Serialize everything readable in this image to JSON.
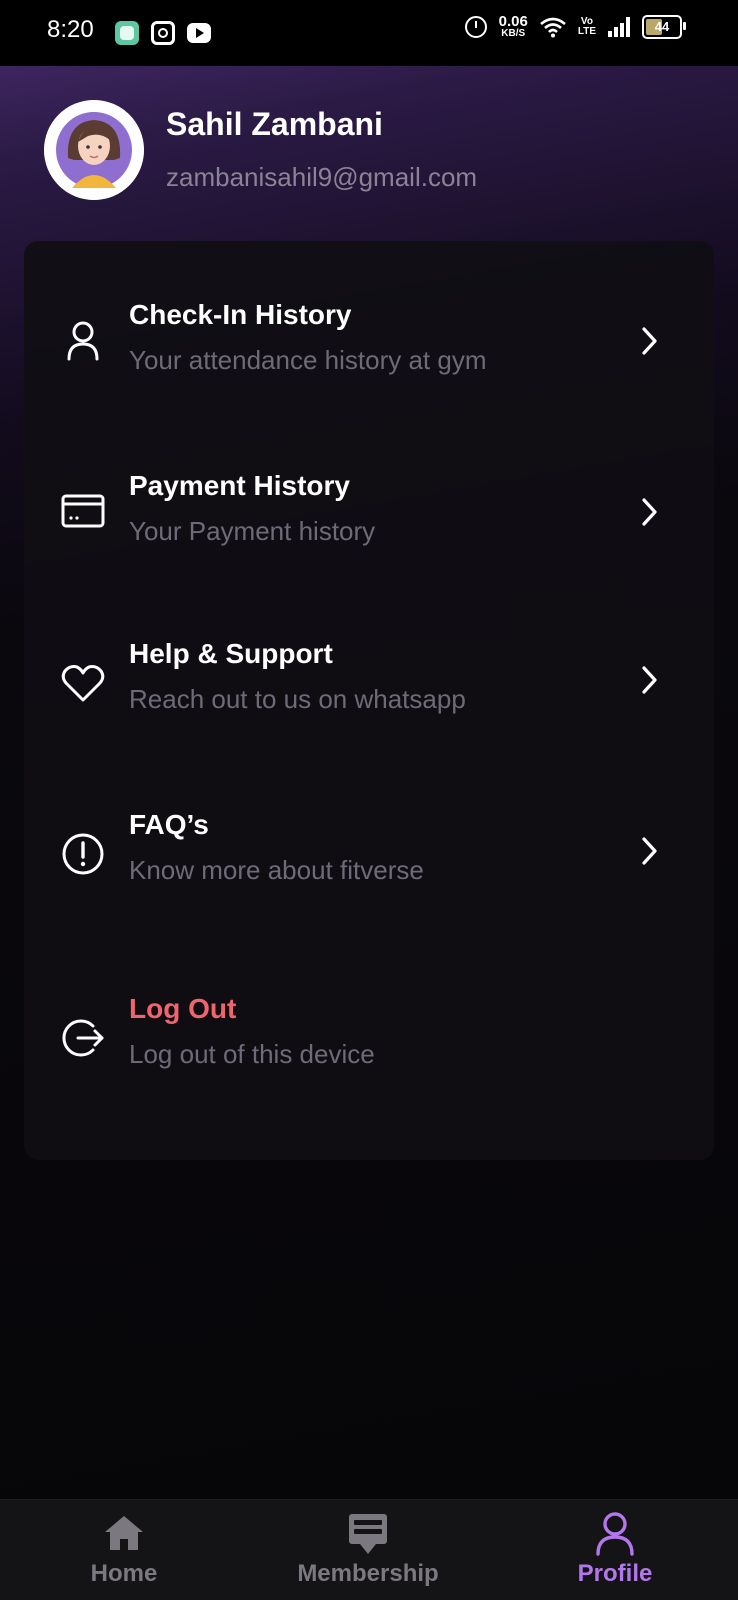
{
  "status_bar": {
    "time": "8:20",
    "net_speed_value": "0.06",
    "net_speed_unit": "KB/S",
    "volte_top": "Vo",
    "volte_bottom": "LTE",
    "battery": "44",
    "icons": [
      "app-notification-icon",
      "instagram-icon",
      "youtube-icon",
      "alarm-icon",
      "wifi-icon",
      "signal-icon",
      "battery-icon"
    ]
  },
  "profile": {
    "name": "Sahil Zambani",
    "email": "zambanisahil9@gmail.com"
  },
  "menu": {
    "items": [
      {
        "title": "Check-In History",
        "subtitle": "Your attendance history at gym",
        "icon": "user-icon",
        "has_chevron": true
      },
      {
        "title": "Payment History",
        "subtitle": "Your Payment history",
        "icon": "card-icon",
        "has_chevron": true
      },
      {
        "title": "Help & Support",
        "subtitle": "Reach out to us on whatsapp",
        "icon": "heart-icon",
        "has_chevron": true
      },
      {
        "title": "FAQ’s",
        "subtitle": "Know more about fitverse",
        "icon": "info-icon",
        "has_chevron": true
      },
      {
        "title": "Log Out",
        "subtitle": "Log out of this device",
        "icon": "logout-icon",
        "has_chevron": false
      }
    ]
  },
  "bottom_nav": {
    "items": [
      {
        "label": "Home",
        "icon": "home-icon",
        "active": false
      },
      {
        "label": "Membership",
        "icon": "membership-icon",
        "active": false
      },
      {
        "label": "Profile",
        "icon": "profile-icon",
        "active": true
      }
    ]
  },
  "colors": {
    "accent": "#b377ec",
    "logout": "#f0646e",
    "subtitle": "#6f6a78",
    "background": "#060508",
    "header_gradient": "#4a2d70"
  }
}
